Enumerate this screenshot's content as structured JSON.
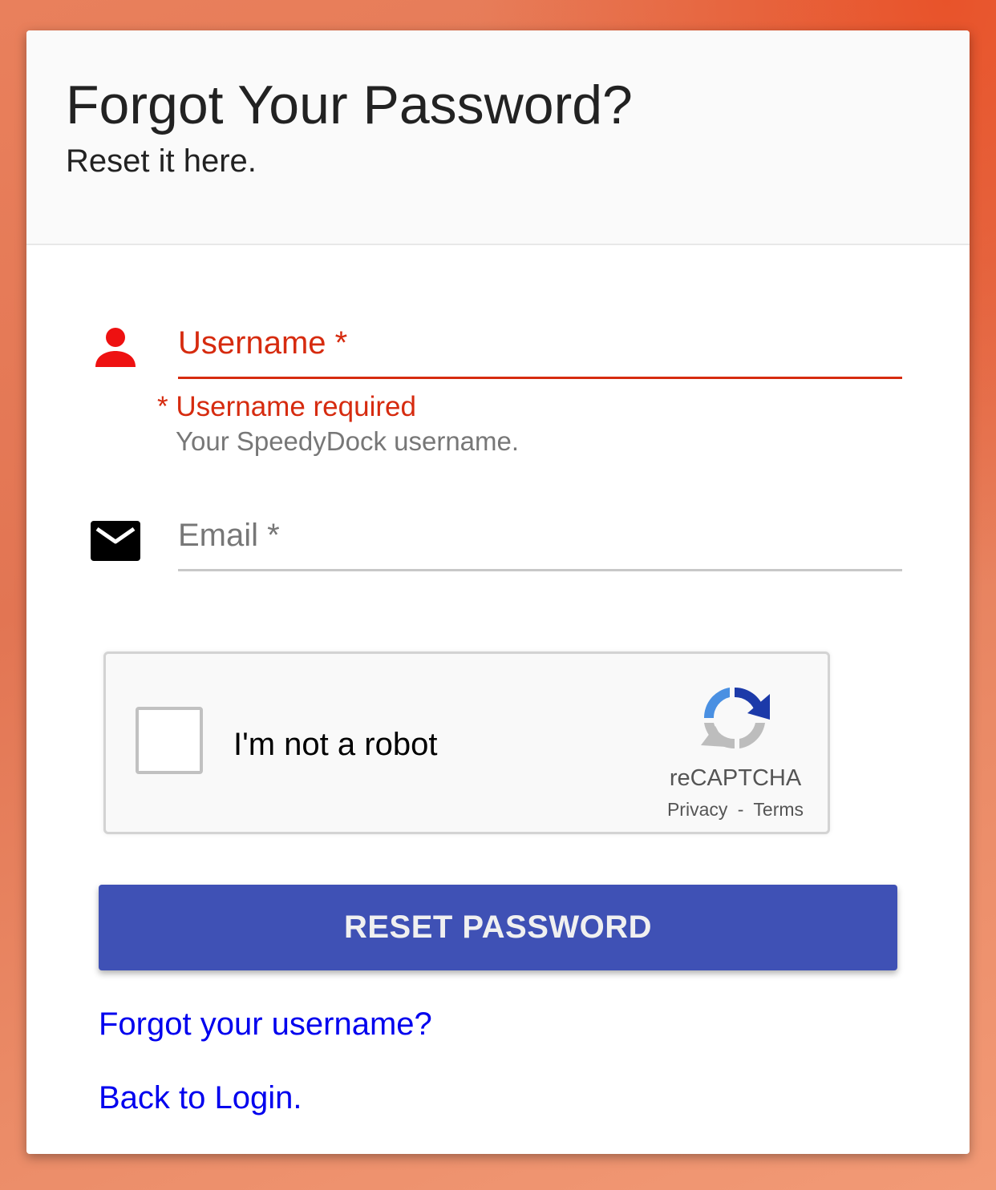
{
  "header": {
    "title": "Forgot Your Password?",
    "subtitle": "Reset it here."
  },
  "form": {
    "username": {
      "label": "Username *",
      "value": "",
      "error": "* Username required",
      "helper": "Your SpeedyDock username.",
      "icon": "person-icon",
      "state": "error"
    },
    "email": {
      "label": "Email *",
      "value": "",
      "icon": "mail-icon"
    }
  },
  "recaptcha": {
    "checkbox_label": "I'm not a robot",
    "checked": false,
    "brand": "reCAPTCHA",
    "privacy": "Privacy",
    "separator": "-",
    "terms": "Terms"
  },
  "actions": {
    "reset_label": "RESET PASSWORD",
    "forgot_username": "Forgot your username?",
    "back_to_login": "Back to Login."
  },
  "colors": {
    "error": "#d62b0f",
    "error_icon": "#ee1111",
    "primary": "#3f51b5",
    "link": "#0000ee",
    "background": "#e27553"
  }
}
